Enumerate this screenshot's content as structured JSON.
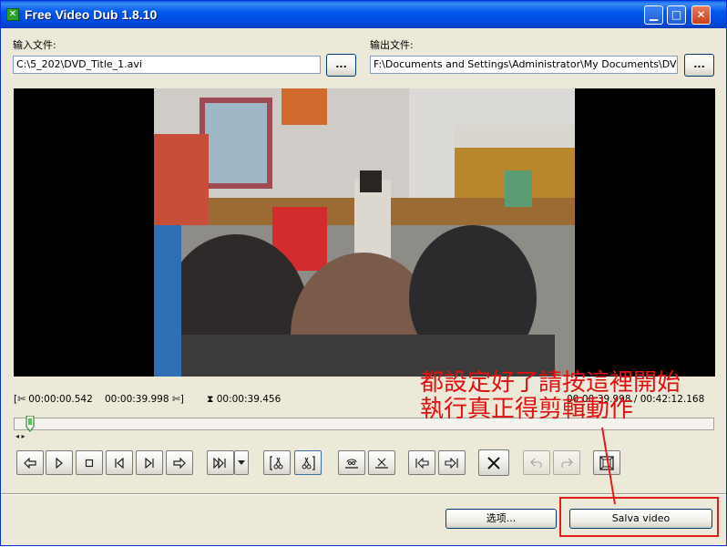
{
  "window": {
    "title": "Free Video Dub 1.8.10"
  },
  "input": {
    "label": "输入文件:",
    "value": "C:\\5_202\\DVD_Title_1.avi",
    "browse_label": "..."
  },
  "output": {
    "label": "输出文件:",
    "value": "F:\\Documents and Settings\\Administrator\\My Documents\\DVDVideoSo",
    "browse_label": "..."
  },
  "timeline": {
    "selection_start": "00:00:00.542",
    "selection_end": "00:00:39.998",
    "selection_length": "00:00:39.456",
    "current_total": "00:00:39.998 / 00:42:12.168",
    "position_fraction": 0.016
  },
  "toolbar_icons": [
    "previous-frame-icon",
    "play-icon",
    "stop-icon",
    "previous-keyframe-icon",
    "next-keyframe-icon",
    "next-frame-icon",
    "skip-end-icon",
    "dropdown-arrow-icon",
    "mark-start-icon",
    "mark-end-icon",
    "goto-selection-start-icon",
    "clear-selection-icon",
    "previous-marker-icon",
    "next-marker-icon",
    "delete-icon",
    "undo-icon",
    "redo-icon",
    "fit-window-icon"
  ],
  "buttons": {
    "options_label": "选项...",
    "save_label": "Salva video"
  },
  "annotation": {
    "line1": "都設定好了請按這裡開始",
    "line2": "執行真正得剪輯動作",
    "color": "#e11111"
  }
}
